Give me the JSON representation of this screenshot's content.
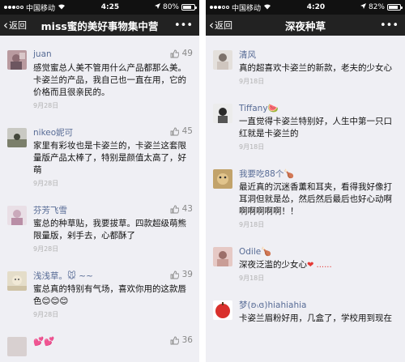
{
  "left": {
    "status": {
      "carrier": "中国移动",
      "time": "4:25",
      "battery": "80%",
      "battery_level": 0.8
    },
    "nav": {
      "back": "返回",
      "title": "miss蜜的美好事物集中营",
      "more": "•••"
    },
    "comments": [
      {
        "name": "juan",
        "likes": "49",
        "text": "感觉蜜总人美不管用什么产品都那么美。卡姿兰的产品，我自己也一直在用，它的价格而且很亲民的。",
        "date": "9月28日",
        "emoji": ""
      },
      {
        "name": "nikeo妮可",
        "likes": "45",
        "text": "家里有彩妆也是卡姿兰的，卡姿兰这套限量版产品太棒了，特别是颜值太高了，好萌",
        "date": "9月28日",
        "emoji": ""
      },
      {
        "name": "芬芳飞雪",
        "likes": "43",
        "text": "蜜总的种草贴，我要拔草。四款超级萌熊限量版，剁手去，心都酥了",
        "date": "9月28日",
        "emoji": ""
      },
      {
        "name": "浅浅草。🐭 ~~",
        "likes": "39",
        "text": "蜜总真的特别有气场，喜欢你用的这款唇色",
        "date": "9月28日",
        "emoji": "😊😊😊"
      },
      {
        "name": "💕💕",
        "likes": "36",
        "text": "",
        "date": "",
        "emoji": ""
      }
    ]
  },
  "right": {
    "status": {
      "carrier": "中国移动",
      "time": "4:20",
      "battery": "82%",
      "battery_level": 0.82
    },
    "nav": {
      "back": "返回",
      "title": "深夜种草",
      "more": "•••"
    },
    "comments": [
      {
        "name": "清风",
        "text": "真的超喜欢卡姿兰的新款，老夫的少女心",
        "date": "9月18日",
        "emoji": ""
      },
      {
        "name": "Tiffany🍉",
        "text": "一直觉得卡姿兰特别好，人生中第一只口红就是卡姿兰的",
        "date": "9月18日",
        "emoji": ""
      },
      {
        "name": "我要吃88个🍗",
        "text": "最近真的沉迷香薰和耳夹，看得我好像打耳洞但就是怂，然后然后最后也好心动啊啊啊啊啊啊！！",
        "date": "9月18日",
        "emoji": ""
      },
      {
        "name": "Odile🍗",
        "text": "深夜泛滥的少女心",
        "date": "9月18日",
        "emoji": "❤ ......"
      },
      {
        "name": "梦(ʚ៶ɞ)hiahiahia",
        "text": "卡姿兰眉粉好用，几盒了，学校用到现在",
        "date": "",
        "emoji": ""
      }
    ]
  },
  "colors": {
    "nav_bg": "#222222",
    "status_bg": "#111111",
    "list_bg": "#efeff4",
    "name": "#576b95",
    "date": "#b2b2b2"
  }
}
